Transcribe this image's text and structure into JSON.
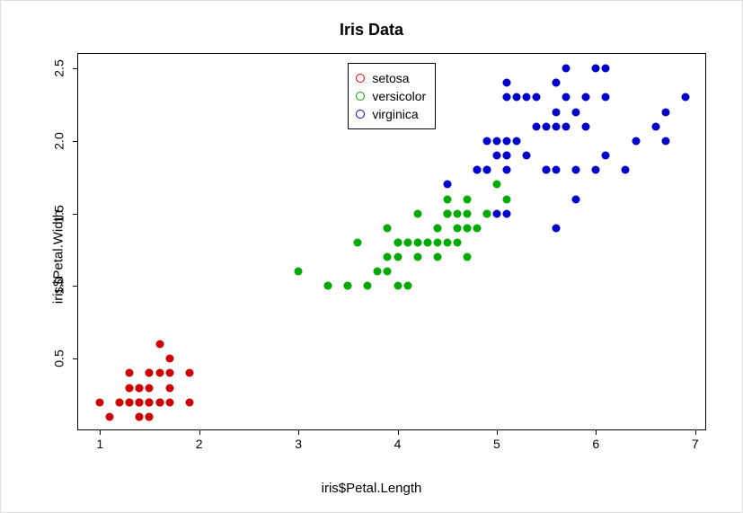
{
  "chart_data": {
    "type": "scatter",
    "title": "Iris Data",
    "xlabel": "iris$Petal.Length",
    "ylabel": "iris$Petal.Width",
    "xlim": [
      0.78,
      7.12
    ],
    "ylim": [
      0.0,
      2.6
    ],
    "xticks": [
      1,
      2,
      3,
      4,
      5,
      6,
      7
    ],
    "yticks": [
      0.5,
      1.0,
      1.5,
      2.0,
      2.5
    ],
    "legend": {
      "position": "top",
      "entries": [
        {
          "name": "setosa",
          "color": "#ee0000",
          "filled": false
        },
        {
          "name": "versicolor",
          "color": "#00aa00",
          "filled": false
        },
        {
          "name": "virginica",
          "color": "#0000cc",
          "filled": false
        }
      ]
    },
    "series": [
      {
        "name": "setosa",
        "color": "#cc0000",
        "filled": true,
        "points": [
          [
            1.4,
            0.2
          ],
          [
            1.4,
            0.2
          ],
          [
            1.3,
            0.2
          ],
          [
            1.5,
            0.2
          ],
          [
            1.4,
            0.2
          ],
          [
            1.7,
            0.4
          ],
          [
            1.4,
            0.3
          ],
          [
            1.5,
            0.2
          ],
          [
            1.4,
            0.2
          ],
          [
            1.5,
            0.1
          ],
          [
            1.5,
            0.2
          ],
          [
            1.6,
            0.2
          ],
          [
            1.4,
            0.1
          ],
          [
            1.1,
            0.1
          ],
          [
            1.2,
            0.2
          ],
          [
            1.5,
            0.4
          ],
          [
            1.3,
            0.4
          ],
          [
            1.4,
            0.3
          ],
          [
            1.7,
            0.3
          ],
          [
            1.5,
            0.3
          ],
          [
            1.7,
            0.2
          ],
          [
            1.5,
            0.4
          ],
          [
            1.0,
            0.2
          ],
          [
            1.7,
            0.5
          ],
          [
            1.9,
            0.2
          ],
          [
            1.6,
            0.2
          ],
          [
            1.6,
            0.4
          ],
          [
            1.5,
            0.2
          ],
          [
            1.4,
            0.2
          ],
          [
            1.6,
            0.2
          ],
          [
            1.6,
            0.2
          ],
          [
            1.5,
            0.4
          ],
          [
            1.5,
            0.1
          ],
          [
            1.4,
            0.2
          ],
          [
            1.5,
            0.2
          ],
          [
            1.2,
            0.2
          ],
          [
            1.3,
            0.2
          ],
          [
            1.4,
            0.1
          ],
          [
            1.3,
            0.2
          ],
          [
            1.5,
            0.2
          ],
          [
            1.3,
            0.3
          ],
          [
            1.3,
            0.3
          ],
          [
            1.3,
            0.2
          ],
          [
            1.6,
            0.6
          ],
          [
            1.9,
            0.4
          ],
          [
            1.4,
            0.3
          ],
          [
            1.6,
            0.2
          ],
          [
            1.4,
            0.2
          ],
          [
            1.5,
            0.2
          ],
          [
            1.4,
            0.2
          ]
        ]
      },
      {
        "name": "versicolor",
        "color": "#00aa00",
        "filled": true,
        "points": [
          [
            4.7,
            1.4
          ],
          [
            4.5,
            1.5
          ],
          [
            4.9,
            1.5
          ],
          [
            4.0,
            1.3
          ],
          [
            4.6,
            1.5
          ],
          [
            4.5,
            1.3
          ],
          [
            4.7,
            1.6
          ],
          [
            3.3,
            1.0
          ],
          [
            4.6,
            1.3
          ],
          [
            3.9,
            1.4
          ],
          [
            3.5,
            1.0
          ],
          [
            4.2,
            1.5
          ],
          [
            4.0,
            1.0
          ],
          [
            4.7,
            1.4
          ],
          [
            3.6,
            1.3
          ],
          [
            4.4,
            1.4
          ],
          [
            4.5,
            1.5
          ],
          [
            4.1,
            1.0
          ],
          [
            4.5,
            1.5
          ],
          [
            3.9,
            1.1
          ],
          [
            4.8,
            1.8
          ],
          [
            4.0,
            1.3
          ],
          [
            4.9,
            1.5
          ],
          [
            4.7,
            1.2
          ],
          [
            4.3,
            1.3
          ],
          [
            4.4,
            1.4
          ],
          [
            4.8,
            1.4
          ],
          [
            5.0,
            1.7
          ],
          [
            4.5,
            1.5
          ],
          [
            3.5,
            1.0
          ],
          [
            3.8,
            1.1
          ],
          [
            3.7,
            1.0
          ],
          [
            3.9,
            1.2
          ],
          [
            5.1,
            1.6
          ],
          [
            4.5,
            1.5
          ],
          [
            4.5,
            1.6
          ],
          [
            4.7,
            1.5
          ],
          [
            4.4,
            1.3
          ],
          [
            4.1,
            1.3
          ],
          [
            4.0,
            1.3
          ],
          [
            4.4,
            1.2
          ],
          [
            4.6,
            1.4
          ],
          [
            4.0,
            1.2
          ],
          [
            3.3,
            1.0
          ],
          [
            4.2,
            1.3
          ],
          [
            4.2,
            1.2
          ],
          [
            4.2,
            1.3
          ],
          [
            4.3,
            1.3
          ],
          [
            3.0,
            1.1
          ],
          [
            4.1,
            1.3
          ]
        ]
      },
      {
        "name": "virginica",
        "color": "#0000cc",
        "filled": true,
        "points": [
          [
            6.0,
            2.5
          ],
          [
            5.1,
            1.9
          ],
          [
            5.9,
            2.1
          ],
          [
            5.6,
            1.8
          ],
          [
            5.8,
            2.2
          ],
          [
            6.6,
            2.1
          ],
          [
            4.5,
            1.7
          ],
          [
            6.3,
            1.8
          ],
          [
            5.8,
            1.8
          ],
          [
            6.1,
            2.5
          ],
          [
            5.1,
            2.0
          ],
          [
            5.3,
            1.9
          ],
          [
            5.5,
            2.1
          ],
          [
            5.0,
            2.0
          ],
          [
            5.1,
            2.4
          ],
          [
            5.3,
            2.3
          ],
          [
            5.5,
            1.8
          ],
          [
            6.7,
            2.2
          ],
          [
            6.9,
            2.3
          ],
          [
            5.0,
            1.5
          ],
          [
            5.7,
            2.3
          ],
          [
            4.9,
            2.0
          ],
          [
            6.7,
            2.0
          ],
          [
            4.9,
            1.8
          ],
          [
            5.7,
            2.1
          ],
          [
            6.0,
            1.8
          ],
          [
            4.8,
            1.8
          ],
          [
            4.9,
            1.8
          ],
          [
            5.6,
            2.1
          ],
          [
            5.8,
            1.6
          ],
          [
            6.1,
            1.9
          ],
          [
            6.4,
            2.0
          ],
          [
            5.6,
            2.2
          ],
          [
            5.1,
            1.5
          ],
          [
            5.6,
            1.4
          ],
          [
            6.1,
            2.3
          ],
          [
            5.6,
            2.4
          ],
          [
            5.5,
            1.8
          ],
          [
            4.8,
            1.8
          ],
          [
            5.4,
            2.1
          ],
          [
            5.6,
            2.4
          ],
          [
            5.1,
            2.3
          ],
          [
            5.1,
            1.9
          ],
          [
            5.9,
            2.3
          ],
          [
            5.7,
            2.5
          ],
          [
            5.2,
            2.3
          ],
          [
            5.0,
            1.9
          ],
          [
            5.2,
            2.0
          ],
          [
            5.4,
            2.3
          ],
          [
            5.1,
            1.8
          ]
        ]
      }
    ]
  }
}
